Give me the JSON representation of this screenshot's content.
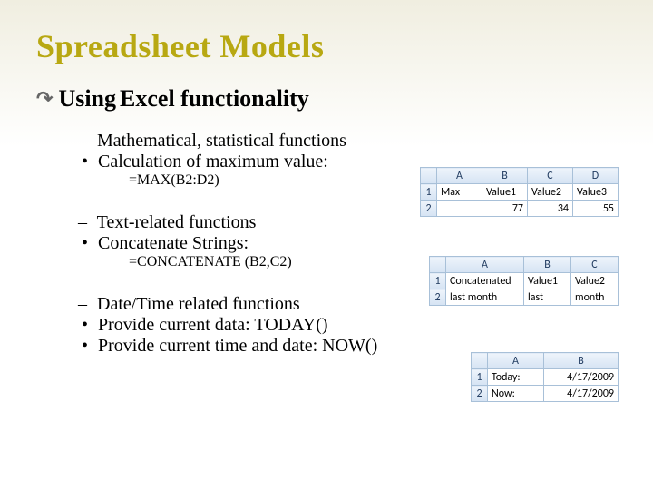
{
  "title": "Spreadsheet Models",
  "subtitle_prefix": "Using",
  "subtitle_rest": " Excel functionality",
  "sections": {
    "s1": {
      "heading": "Mathematical, statistical functions",
      "bullet": "Calculation of maximum value:",
      "formula": "=MAX(B2:D2)"
    },
    "s2": {
      "heading": "Text-related functions",
      "bullet": "Concatenate Strings:",
      "formula": "=CONCATENATE (B2,C2)"
    },
    "s3": {
      "heading": "Date/Time related functions",
      "bullet1": "Provide current data: TODAY()",
      "bullet2": "Provide current time and date: NOW()"
    }
  },
  "tables": {
    "t1": {
      "cols": [
        "A",
        "B",
        "C",
        "D"
      ],
      "row1": [
        "Max",
        "Value1",
        "Value2",
        "Value3"
      ],
      "row2": [
        "",
        "77",
        "34",
        "55"
      ]
    },
    "t2": {
      "cols": [
        "A",
        "B",
        "C"
      ],
      "row1": [
        "Concatenated",
        "Value1",
        "Value2"
      ],
      "row2": [
        "last month",
        "last",
        "month"
      ]
    },
    "t3": {
      "cols": [
        "A",
        "B"
      ],
      "row1": [
        "Today:",
        "4/17/2009"
      ],
      "row2": [
        "Now:",
        "4/17/2009"
      ]
    }
  }
}
